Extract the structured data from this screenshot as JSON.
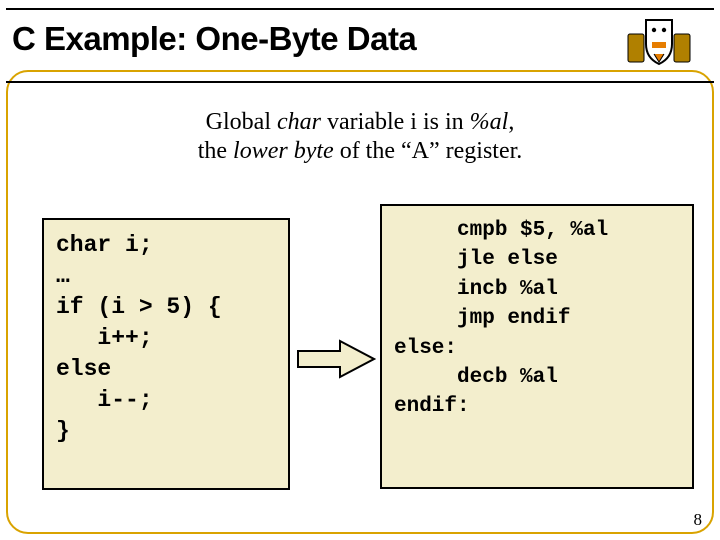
{
  "title": "C Example: One-Byte Data",
  "subtitle": {
    "line1_prefix": "Global ",
    "line1_ital1": "char",
    "line1_mid": " variable i is in ",
    "line1_ital2": "%al",
    "line1_suffix": ",",
    "line2_prefix": "the ",
    "line2_ital": "lower byte",
    "line2_suffix": " of the “A” register."
  },
  "code_c": "char i;\n…\nif (i > 5) {\n   i++;\nelse\n   i--;\n}",
  "code_asm": "     cmpb $5, %al\n     jle else\n     incb %al\n     jmp endif\nelse:\n     decb %al\nendif:",
  "pagenum": "8"
}
